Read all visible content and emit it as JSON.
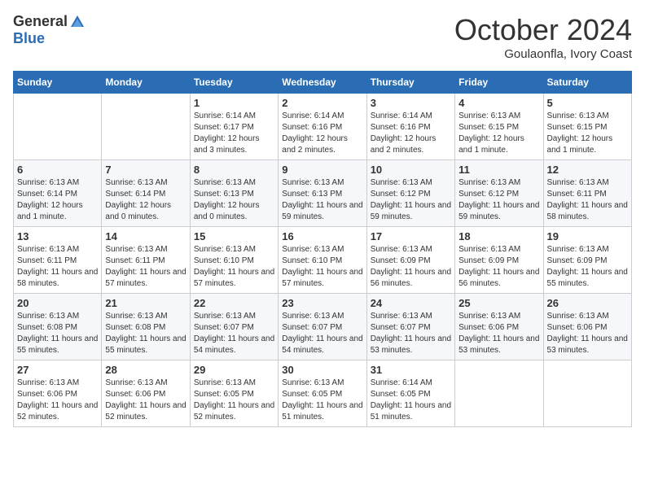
{
  "header": {
    "logo": {
      "general": "General",
      "blue": "Blue"
    },
    "title": "October 2024",
    "subtitle": "Goulaonfla, Ivory Coast"
  },
  "calendar": {
    "weekdays": [
      "Sunday",
      "Monday",
      "Tuesday",
      "Wednesday",
      "Thursday",
      "Friday",
      "Saturday"
    ],
    "weeks": [
      [
        {
          "day": "",
          "sunrise": "",
          "sunset": "",
          "daylight": ""
        },
        {
          "day": "",
          "sunrise": "",
          "sunset": "",
          "daylight": ""
        },
        {
          "day": "1",
          "sunrise": "Sunrise: 6:14 AM",
          "sunset": "Sunset: 6:17 PM",
          "daylight": "Daylight: 12 hours and 3 minutes."
        },
        {
          "day": "2",
          "sunrise": "Sunrise: 6:14 AM",
          "sunset": "Sunset: 6:16 PM",
          "daylight": "Daylight: 12 hours and 2 minutes."
        },
        {
          "day": "3",
          "sunrise": "Sunrise: 6:14 AM",
          "sunset": "Sunset: 6:16 PM",
          "daylight": "Daylight: 12 hours and 2 minutes."
        },
        {
          "day": "4",
          "sunrise": "Sunrise: 6:13 AM",
          "sunset": "Sunset: 6:15 PM",
          "daylight": "Daylight: 12 hours and 1 minute."
        },
        {
          "day": "5",
          "sunrise": "Sunrise: 6:13 AM",
          "sunset": "Sunset: 6:15 PM",
          "daylight": "Daylight: 12 hours and 1 minute."
        }
      ],
      [
        {
          "day": "6",
          "sunrise": "Sunrise: 6:13 AM",
          "sunset": "Sunset: 6:14 PM",
          "daylight": "Daylight: 12 hours and 1 minute."
        },
        {
          "day": "7",
          "sunrise": "Sunrise: 6:13 AM",
          "sunset": "Sunset: 6:14 PM",
          "daylight": "Daylight: 12 hours and 0 minutes."
        },
        {
          "day": "8",
          "sunrise": "Sunrise: 6:13 AM",
          "sunset": "Sunset: 6:13 PM",
          "daylight": "Daylight: 12 hours and 0 minutes."
        },
        {
          "day": "9",
          "sunrise": "Sunrise: 6:13 AM",
          "sunset": "Sunset: 6:13 PM",
          "daylight": "Daylight: 11 hours and 59 minutes."
        },
        {
          "day": "10",
          "sunrise": "Sunrise: 6:13 AM",
          "sunset": "Sunset: 6:12 PM",
          "daylight": "Daylight: 11 hours and 59 minutes."
        },
        {
          "day": "11",
          "sunrise": "Sunrise: 6:13 AM",
          "sunset": "Sunset: 6:12 PM",
          "daylight": "Daylight: 11 hours and 59 minutes."
        },
        {
          "day": "12",
          "sunrise": "Sunrise: 6:13 AM",
          "sunset": "Sunset: 6:11 PM",
          "daylight": "Daylight: 11 hours and 58 minutes."
        }
      ],
      [
        {
          "day": "13",
          "sunrise": "Sunrise: 6:13 AM",
          "sunset": "Sunset: 6:11 PM",
          "daylight": "Daylight: 11 hours and 58 minutes."
        },
        {
          "day": "14",
          "sunrise": "Sunrise: 6:13 AM",
          "sunset": "Sunset: 6:11 PM",
          "daylight": "Daylight: 11 hours and 57 minutes."
        },
        {
          "day": "15",
          "sunrise": "Sunrise: 6:13 AM",
          "sunset": "Sunset: 6:10 PM",
          "daylight": "Daylight: 11 hours and 57 minutes."
        },
        {
          "day": "16",
          "sunrise": "Sunrise: 6:13 AM",
          "sunset": "Sunset: 6:10 PM",
          "daylight": "Daylight: 11 hours and 57 minutes."
        },
        {
          "day": "17",
          "sunrise": "Sunrise: 6:13 AM",
          "sunset": "Sunset: 6:09 PM",
          "daylight": "Daylight: 11 hours and 56 minutes."
        },
        {
          "day": "18",
          "sunrise": "Sunrise: 6:13 AM",
          "sunset": "Sunset: 6:09 PM",
          "daylight": "Daylight: 11 hours and 56 minutes."
        },
        {
          "day": "19",
          "sunrise": "Sunrise: 6:13 AM",
          "sunset": "Sunset: 6:09 PM",
          "daylight": "Daylight: 11 hours and 55 minutes."
        }
      ],
      [
        {
          "day": "20",
          "sunrise": "Sunrise: 6:13 AM",
          "sunset": "Sunset: 6:08 PM",
          "daylight": "Daylight: 11 hours and 55 minutes."
        },
        {
          "day": "21",
          "sunrise": "Sunrise: 6:13 AM",
          "sunset": "Sunset: 6:08 PM",
          "daylight": "Daylight: 11 hours and 55 minutes."
        },
        {
          "day": "22",
          "sunrise": "Sunrise: 6:13 AM",
          "sunset": "Sunset: 6:07 PM",
          "daylight": "Daylight: 11 hours and 54 minutes."
        },
        {
          "day": "23",
          "sunrise": "Sunrise: 6:13 AM",
          "sunset": "Sunset: 6:07 PM",
          "daylight": "Daylight: 11 hours and 54 minutes."
        },
        {
          "day": "24",
          "sunrise": "Sunrise: 6:13 AM",
          "sunset": "Sunset: 6:07 PM",
          "daylight": "Daylight: 11 hours and 53 minutes."
        },
        {
          "day": "25",
          "sunrise": "Sunrise: 6:13 AM",
          "sunset": "Sunset: 6:06 PM",
          "daylight": "Daylight: 11 hours and 53 minutes."
        },
        {
          "day": "26",
          "sunrise": "Sunrise: 6:13 AM",
          "sunset": "Sunset: 6:06 PM",
          "daylight": "Daylight: 11 hours and 53 minutes."
        }
      ],
      [
        {
          "day": "27",
          "sunrise": "Sunrise: 6:13 AM",
          "sunset": "Sunset: 6:06 PM",
          "daylight": "Daylight: 11 hours and 52 minutes."
        },
        {
          "day": "28",
          "sunrise": "Sunrise: 6:13 AM",
          "sunset": "Sunset: 6:06 PM",
          "daylight": "Daylight: 11 hours and 52 minutes."
        },
        {
          "day": "29",
          "sunrise": "Sunrise: 6:13 AM",
          "sunset": "Sunset: 6:05 PM",
          "daylight": "Daylight: 11 hours and 52 minutes."
        },
        {
          "day": "30",
          "sunrise": "Sunrise: 6:13 AM",
          "sunset": "Sunset: 6:05 PM",
          "daylight": "Daylight: 11 hours and 51 minutes."
        },
        {
          "day": "31",
          "sunrise": "Sunrise: 6:14 AM",
          "sunset": "Sunset: 6:05 PM",
          "daylight": "Daylight: 11 hours and 51 minutes."
        },
        {
          "day": "",
          "sunrise": "",
          "sunset": "",
          "daylight": ""
        },
        {
          "day": "",
          "sunrise": "",
          "sunset": "",
          "daylight": ""
        }
      ]
    ]
  }
}
